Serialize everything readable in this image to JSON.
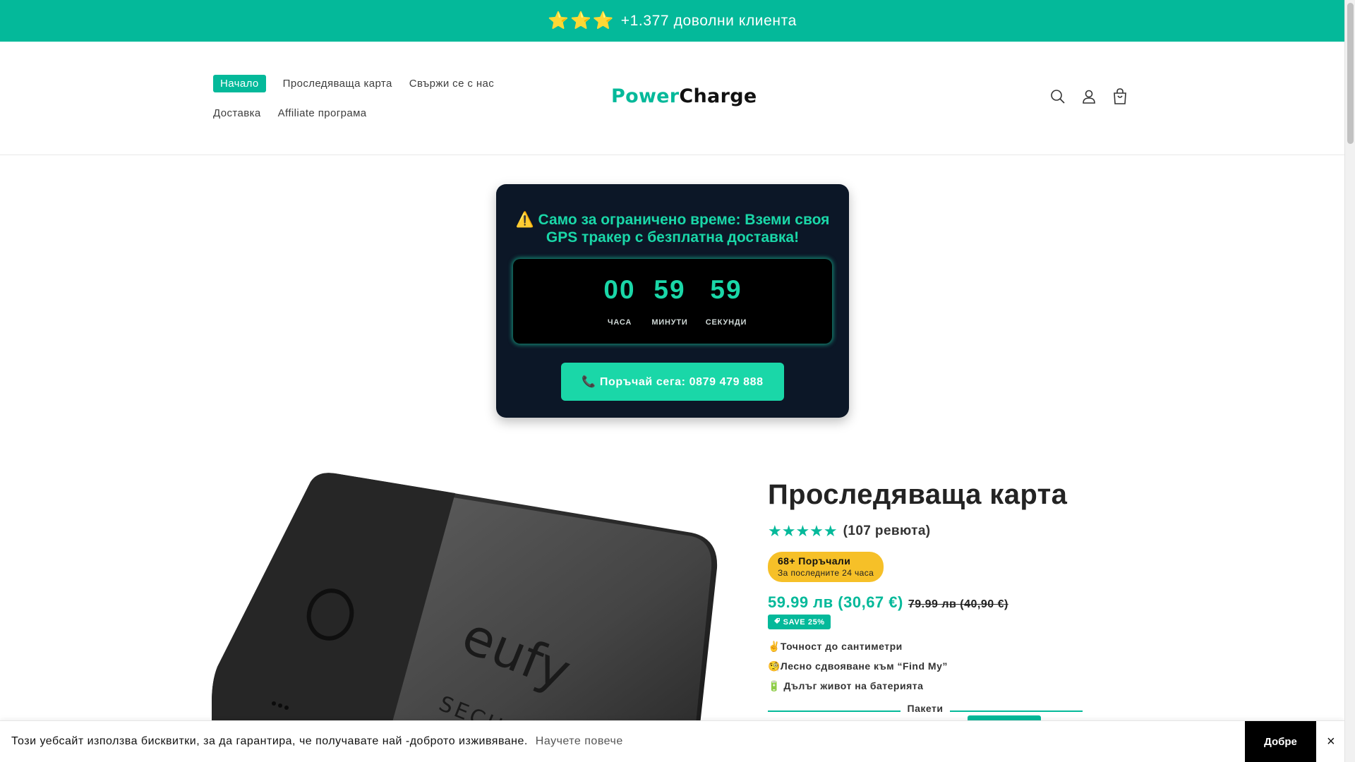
{
  "announcement": {
    "stars": "⭐⭐⭐",
    "text": "+1.377 доволни клиента"
  },
  "nav": {
    "row1": [
      "Начало",
      "Проследяваща карта",
      "Свържи се с нас"
    ],
    "row2": [
      "Доставка",
      "Affiliate програма"
    ],
    "active": "Начало"
  },
  "logo": {
    "part1": "Power",
    "part2": "Charge"
  },
  "header_icons": [
    "search-icon",
    "account-icon",
    "cart-icon"
  ],
  "promo": {
    "title": "⚠️ Само за ограничено време: Вземи своя GPS тракер с безплатна доставка!",
    "timer": {
      "hours": "00",
      "hours_label": "ЧАСА",
      "minutes": "59",
      "minutes_label": "МИНУТИ",
      "seconds": "59",
      "seconds_label": "СЕКУНДИ"
    },
    "button": "📞 Поръчай сега: 0879 479 888"
  },
  "product": {
    "title": "Проследяваща карта",
    "stars": "★★★★★",
    "reviews": "(107 ревюта)",
    "orders_line1": "68+ Поръчали",
    "orders_line2": "За последните 24 часа",
    "price": "59.99 лв (30,67 €)",
    "old_price": "79.99 лв (40,90 €)",
    "save": "SAVE 25%",
    "features": [
      "✌️Точност до сантиметри",
      "🧐Лесно сдвояване към “Find My”",
      "🔋 Дълъг живот на батерията"
    ],
    "bundles_label": "Пакети",
    "image_brand": "eufy",
    "image_sub": "SECU"
  },
  "cookie": {
    "message": "Този уебсайт използва бисквитки, за да гарантира, че получавате най -доброто изживяване.",
    "more": "Научете повече",
    "accept": "Добре",
    "close": "×"
  },
  "colors": {
    "brand": "#04b99a",
    "accent": "#1ad7a8",
    "promo_bg": "#0c1727",
    "pill": "#f6c028"
  }
}
